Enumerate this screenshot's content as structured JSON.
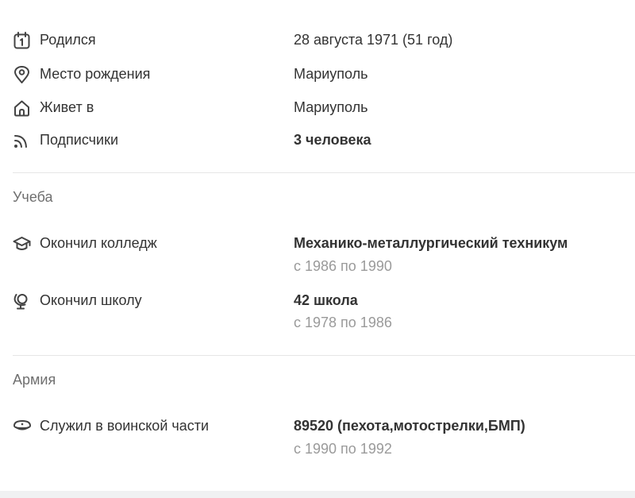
{
  "info": {
    "born": {
      "label": "Родился",
      "value": "28 августа 1971 (51 год)",
      "icon": "calendar-icon"
    },
    "birthplace": {
      "label": "Место рождения",
      "value": "Мариуполь",
      "icon": "location-pin-icon"
    },
    "lives": {
      "label": "Живет в",
      "value": "Мариуполь",
      "icon": "home-icon"
    },
    "followers": {
      "label": "Подписчики",
      "value": "3 человека",
      "icon": "rss-icon"
    }
  },
  "education": {
    "heading": "Учеба",
    "college": {
      "label": "Окончил колледж",
      "value": "Механико-металлургический техникум",
      "period": "с 1986 по 1990",
      "icon": "graduation-cap-icon"
    },
    "school": {
      "label": "Окончил школу",
      "value": "42 школа",
      "period": "с 1978 по 1986",
      "icon": "globe-icon"
    }
  },
  "army": {
    "heading": "Армия",
    "unit": {
      "label": "Служил в воинской части",
      "value": "89520 (пехота,мотострелки,БМП)",
      "period": "с 1990 по 1992",
      "icon": "military-cap-icon"
    }
  },
  "colors": {
    "text": "#333333",
    "muted": "#9a9a9a",
    "heading": "#6f6f6f",
    "divider": "#e6e6e6",
    "icon": "#444444"
  }
}
